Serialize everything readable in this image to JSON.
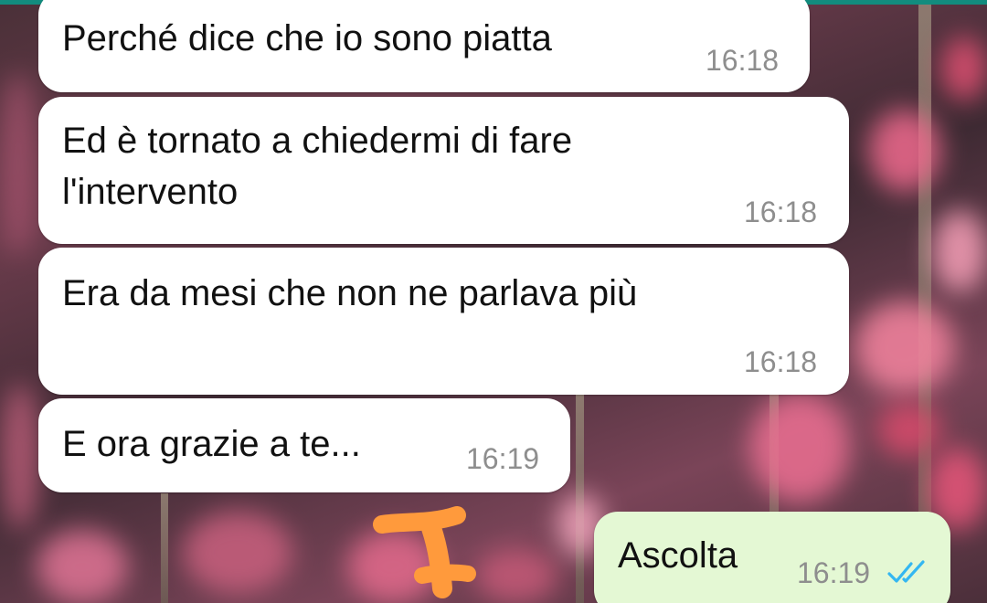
{
  "theme": {
    "top_bar_color": "#128C7E",
    "incoming_bubble_color": "#ffffff",
    "outgoing_bubble_color": "#e4f8d4",
    "timestamp_color": "#8e8e8e",
    "read_tick_color": "#34b7f1",
    "redaction_scribble_color": "#ff9a3c"
  },
  "messages": [
    {
      "direction": "incoming",
      "text": "Perché dice che io sono piatta",
      "time": "16:18"
    },
    {
      "direction": "incoming",
      "text": "Ed è tornato a chiedermi di fare\nl'intervento",
      "time": "16:18"
    },
    {
      "direction": "incoming",
      "text": "Era da mesi che non ne parlava più",
      "time": "16:18"
    },
    {
      "direction": "incoming",
      "text": "E ora grazie a te...",
      "time": "16:19"
    },
    {
      "direction": "outgoing",
      "text": "Ascolta",
      "time": "16:19",
      "status": "read",
      "status_icon": "double-check-icon"
    }
  ],
  "wallpaper": "pink-blossom-wallpaper"
}
